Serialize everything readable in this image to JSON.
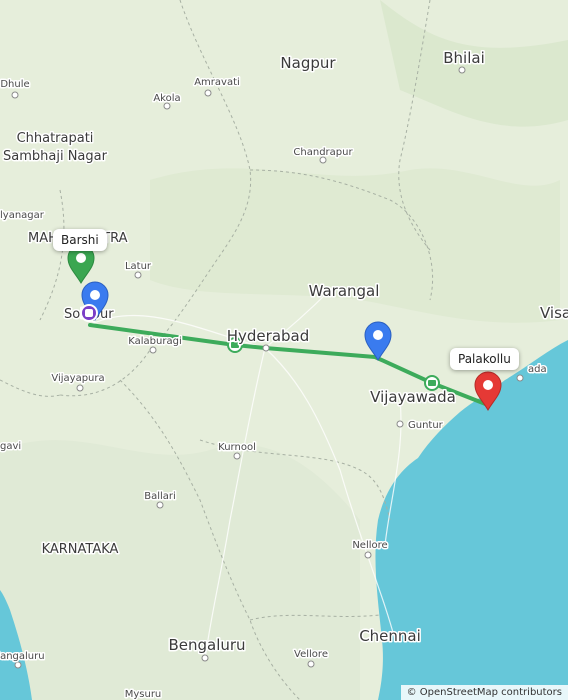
{
  "map": {
    "labels_large": [
      "Nagpur",
      "Bhilai",
      "Hyderabad",
      "Warangal",
      "Vijayawada",
      "Bengaluru",
      "Chennai",
      "Visa"
    ],
    "labels_medium": [
      "Chhatrapati",
      "Sambhaji Nagar",
      "MAHARASHTRA",
      "KARNATAKA",
      "Solapur"
    ],
    "labels_small": [
      "Dhule",
      "Amravati",
      "Akola",
      "Chandrapur",
      "lyanagar",
      "Latur",
      "Kalaburagi",
      "Vijayapura",
      "Guntur",
      "Kurnool",
      "Ballari",
      "Nellore",
      "Vellore",
      "Mysuru",
      "gavi",
      "Mangaluru",
      "ada"
    ],
    "callouts": {
      "origin": "Barshi",
      "destination": "Palakollu"
    },
    "attribution": "© OpenStreetMap contributors",
    "colors": {
      "land": "#e6eedb",
      "water": "#66c7d9",
      "route": "#3dab5b",
      "origin_pin": "#3aa651",
      "dest_pin": "#e53935",
      "waypoint_pin": "#3a7bef",
      "border": "#a7b0a3"
    }
  }
}
